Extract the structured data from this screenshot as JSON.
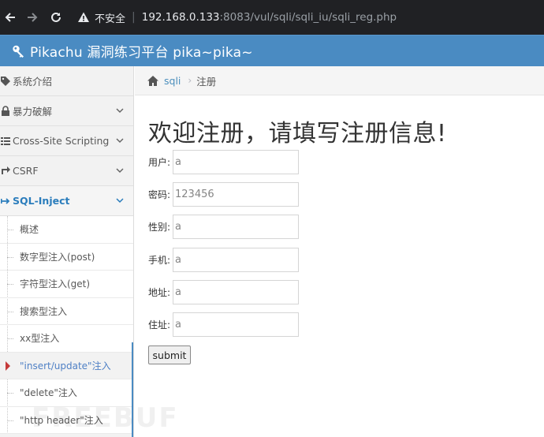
{
  "browser": {
    "insecure_label": "不安全",
    "url_host": "192.168.0.133",
    "url_rest": ":8083/vul/sqli/sqli_iu/sqli_reg.php"
  },
  "app": {
    "title": "Pikachu 漏洞练习平台 pika~pika~"
  },
  "sidebar": {
    "items": [
      {
        "label": "系统介绍",
        "icon": "tag-icon"
      },
      {
        "label": "暴力破解",
        "icon": "lock-icon"
      },
      {
        "label": "Cross-Site Scripting",
        "icon": "list-icon"
      },
      {
        "label": "CSRF",
        "icon": "share-icon"
      },
      {
        "label": "SQL-Inject",
        "icon": "arrow-icon"
      }
    ],
    "sub_items": [
      {
        "label": "概述"
      },
      {
        "label": "数字型注入(post)"
      },
      {
        "label": "字符型注入(get)"
      },
      {
        "label": "搜索型注入"
      },
      {
        "label": "xx型注入"
      },
      {
        "label": "\"insert/update\"注入"
      },
      {
        "label": "\"delete\"注入"
      },
      {
        "label": "\"http header\"注入"
      }
    ]
  },
  "breadcrumb": {
    "link": "sqli",
    "current": "注册"
  },
  "main": {
    "title": "欢迎注册，请填写注册信息!",
    "fields": [
      {
        "label": "用户:",
        "value": "a"
      },
      {
        "label": "密码:",
        "value": "123456"
      },
      {
        "label": "性别:",
        "value": "a"
      },
      {
        "label": "手机:",
        "value": "a"
      },
      {
        "label": "地址:",
        "value": "a"
      },
      {
        "label": "住址:",
        "value": "a"
      }
    ],
    "submit_label": "submit"
  },
  "watermark": "FREEBUF",
  "colors": {
    "header": "#4a8bc2",
    "active_link": "#2b7dbc",
    "current_caret": "#c53a3a"
  }
}
